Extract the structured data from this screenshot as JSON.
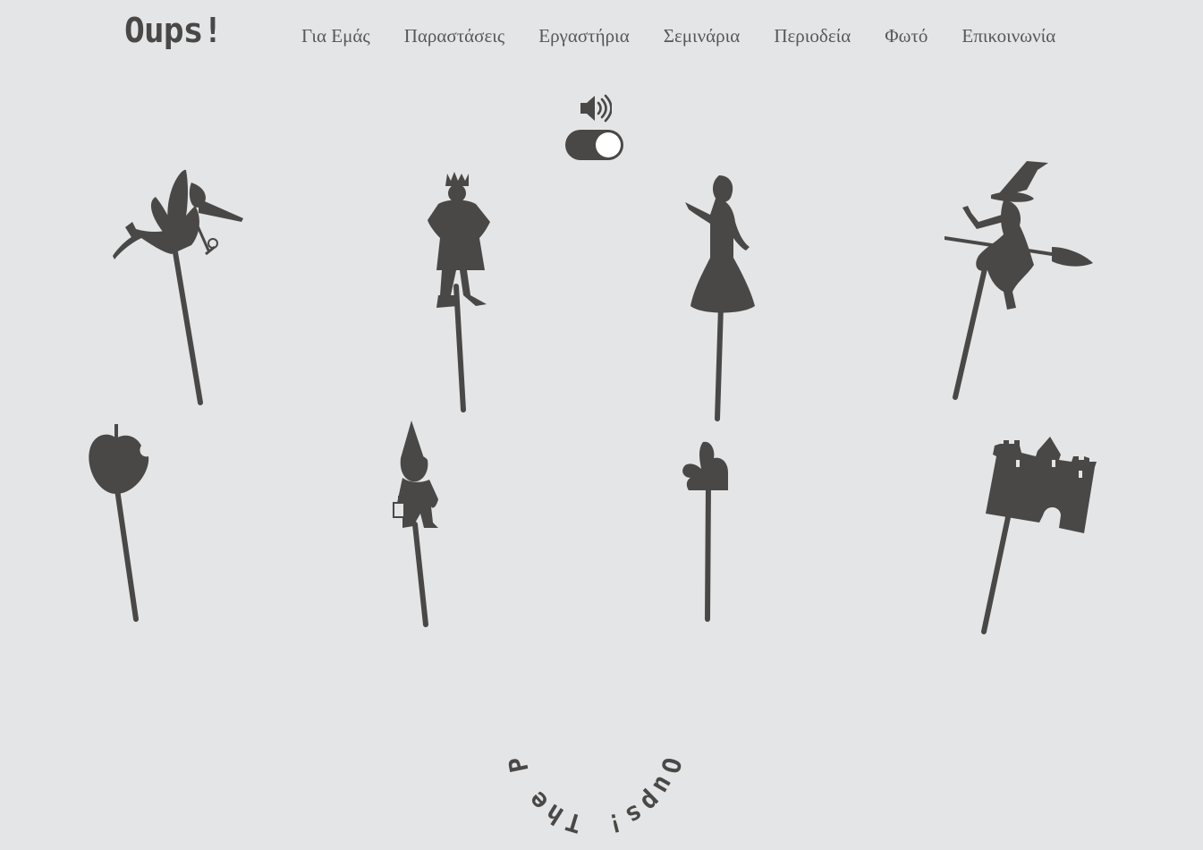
{
  "brand": {
    "logo": "Oups!"
  },
  "nav": {
    "items": [
      {
        "label": "Για Εμάς"
      },
      {
        "label": "Παραστάσεις"
      },
      {
        "label": "Εργαστήρια"
      },
      {
        "label": "Σεμινάρια"
      },
      {
        "label": "Περιοδεία"
      },
      {
        "label": "Φωτό"
      },
      {
        "label": "Επικοινωνία"
      }
    ]
  },
  "sound": {
    "icon": "speaker-icon",
    "toggle_on": true
  },
  "puppets": [
    {
      "icon": "fairy-puppet"
    },
    {
      "icon": "prince-puppet"
    },
    {
      "icon": "princess-puppet"
    },
    {
      "icon": "witch-puppet"
    },
    {
      "icon": "apple-puppet"
    },
    {
      "icon": "gnome-puppet"
    },
    {
      "icon": "rabbit-puppet"
    },
    {
      "icon": "castle-puppet"
    }
  ],
  "stamp": {
    "text": "Oups! The Puppet Theater"
  },
  "colors": {
    "background": "#e4e5e6",
    "silhouette": "#4a4846",
    "nav_text": "#5a5856"
  }
}
